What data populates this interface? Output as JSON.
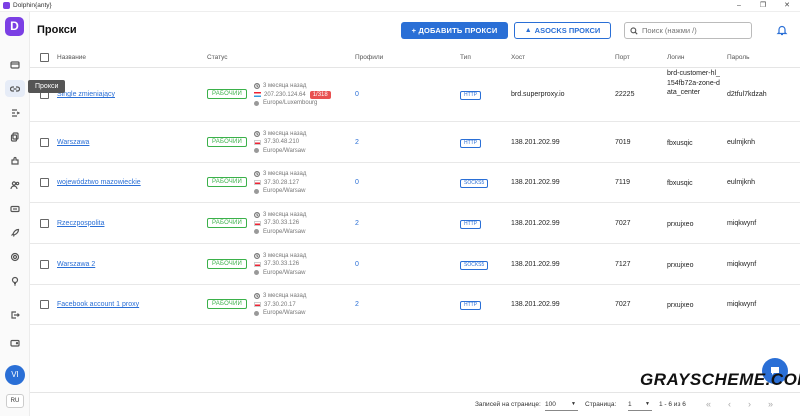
{
  "window": {
    "title": "Dolphin{anty}",
    "controls": [
      "–",
      "❐",
      "✕"
    ]
  },
  "sidebar": {
    "logo": "D",
    "tooltip": "Прокси",
    "avatar": "VI",
    "lang": "RU",
    "icons": [
      "browser-icon",
      "proxy-icon",
      "automation-icon",
      "copy-icon",
      "extensions-icon",
      "users-icon",
      "api-icon",
      "rocket-icon",
      "settings-icon",
      "lightbulb-icon",
      "logout-icon",
      "wallet-icon"
    ]
  },
  "header": {
    "title": "Прокси",
    "add_button": "+ ДОБАВИТЬ ПРОКСИ",
    "asocks_button": "ASOCKS ПРОКСИ",
    "search_placeholder": "Поиск (нажми /)"
  },
  "table": {
    "columns": [
      "Название",
      "Статус",
      "Профили",
      "Тип",
      "Хост",
      "Порт",
      "Логин",
      "Пароль"
    ],
    "rows": [
      {
        "name": "Single zmieniający",
        "status": "РАБОЧИЙ",
        "time": "3 месяца назад",
        "ip": "207.230.124.64",
        "flag": "lu",
        "region": "Europe/Luxembourg",
        "badge": "1/318",
        "profiles": "0",
        "type": "HTTP",
        "host": "brd.superproxy.io",
        "port": "22225",
        "login": "brd-customer-hl_154fb72a-zone-data_center",
        "password": "d2tful7kdzah"
      },
      {
        "name": "Warszawa",
        "status": "РАБОЧИЙ",
        "time": "3 месяца назад",
        "ip": "37.30.48.210",
        "flag": "pl",
        "region": "Europe/Warsaw",
        "badge": "",
        "profiles": "2",
        "type": "HTTP",
        "host": "138.201.202.99",
        "port": "7019",
        "login": "fbxusqic",
        "password": "eulmjknh"
      },
      {
        "name": "województwo mazowieckie",
        "status": "РАБОЧИЙ",
        "time": "3 месяца назад",
        "ip": "37.30.28.127",
        "flag": "pl",
        "region": "Europe/Warsaw",
        "badge": "",
        "profiles": "0",
        "type": "SOCKS5",
        "host": "138.201.202.99",
        "port": "7119",
        "login": "fbxusqic",
        "password": "eulmjknh"
      },
      {
        "name": "Rzeczpospolita",
        "status": "РАБОЧИЙ",
        "time": "3 месяца назад",
        "ip": "37.30.33.126",
        "flag": "pl",
        "region": "Europe/Warsaw",
        "badge": "",
        "profiles": "2",
        "type": "HTTP",
        "host": "138.201.202.99",
        "port": "7027",
        "login": "prxujxeo",
        "password": "miqkwynf"
      },
      {
        "name": "Warszawa 2",
        "status": "РАБОЧИЙ",
        "time": "3 месяца назад",
        "ip": "37.30.33.126",
        "flag": "pl",
        "region": "Europe/Warsaw",
        "badge": "",
        "profiles": "0",
        "type": "SOCKS5",
        "host": "138.201.202.99",
        "port": "7127",
        "login": "prxujxeo",
        "password": "miqkwynf"
      },
      {
        "name": "Facebook account 1 proxy",
        "status": "РАБОЧИЙ",
        "time": "3 месяца назад",
        "ip": "37.30.20.17",
        "flag": "pl",
        "region": "Europe/Warsaw",
        "badge": "",
        "profiles": "2",
        "type": "HTTP",
        "host": "138.201.202.99",
        "port": "7027",
        "login": "prxujxeo",
        "password": "miqkwynf"
      }
    ]
  },
  "footer": {
    "per_page_label": "Записей на странице:",
    "per_page_value": "100",
    "page_label": "Страница:",
    "page_value": "1",
    "range": "1 - 6 из 6"
  },
  "watermark": "GRAYSCHEME.COM",
  "colors": {
    "brand": "#7b3fe4",
    "accent": "#2a6fd6",
    "status_ok": "#3bb14a",
    "badge_red": "#e85050"
  }
}
